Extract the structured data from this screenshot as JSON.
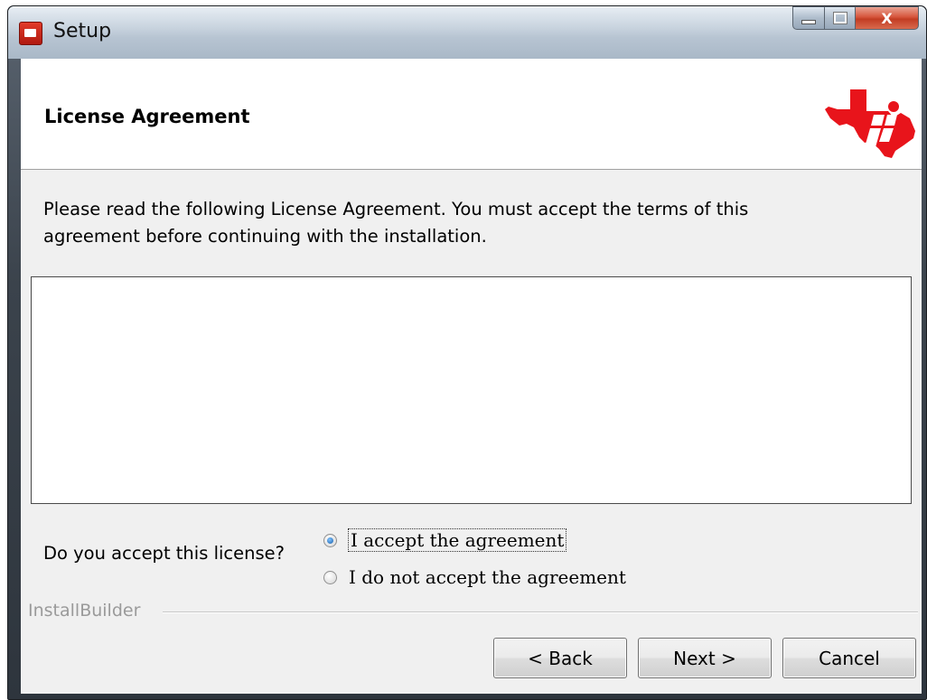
{
  "window": {
    "title": "Setup",
    "controls": {
      "close_glyph": "X"
    }
  },
  "header": {
    "title": "License Agreement",
    "logo_icon": "texas-instruments-logo"
  },
  "intro": {
    "line1": "Please read the following License Agreement. You must accept the terms of this",
    "line2": "agreement before continuing with the installation."
  },
  "license": {
    "text": ""
  },
  "acceptance": {
    "question": "Do you accept this license?",
    "options": [
      {
        "label": "I accept the agreement",
        "selected": true
      },
      {
        "label": "I do not accept the agreement",
        "selected": false
      }
    ]
  },
  "footer": {
    "brand": "InstallBuilder",
    "back_label": "< Back",
    "next_label": "Next >",
    "cancel_label": "Cancel"
  },
  "colors": {
    "logo_red": "#e8141b",
    "close_red": "#c23d23"
  }
}
